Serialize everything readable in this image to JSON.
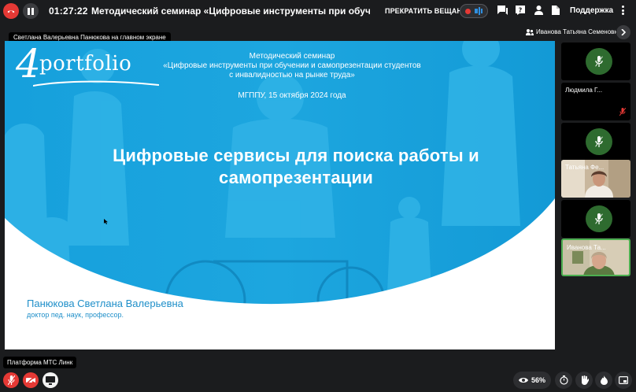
{
  "topbar": {
    "timer": "01:27:22",
    "meeting_title": "Методический семинар «Цифровые инструменты при обучении и самопрезентации студентов с инвалидностью на рынке труда»",
    "stop_stream_label": "ПРЕКРАТИТЬ ВЕЩАНИЕ",
    "support_label": "Поддержка",
    "icons": [
      "hang-up-icon",
      "pause-icon",
      "record-dot-icon",
      "stream-icon",
      "chat-icon",
      "question-icon",
      "user-icon",
      "document-icon",
      "more-icon"
    ]
  },
  "main_screen_label": "Светлана Валерьевна Панюкова на главном экране",
  "active_speaker": "Иванова Татьяна Семеновна",
  "slide": {
    "logo_number": "4",
    "logo_word": "portfolio",
    "header_line1": "Методический семинар",
    "header_line2": "«Цифровые инструменты при обучении и самопрезентации студентов",
    "header_line3": "с инвалидностью на рынке труда»",
    "date": "МГППУ, 15 октября 2024 года",
    "title_line1": "Цифровые сервисы для поиска работы и",
    "title_line2": "самопрезентации",
    "author_name": "Панюкова Светлана Валерьевна",
    "author_title": "доктор пед. наук, профессор."
  },
  "participants": [
    {
      "name": "",
      "kind": "mic"
    },
    {
      "name": "Людмила Г...",
      "kind": "name-muted"
    },
    {
      "name": "",
      "kind": "mic"
    },
    {
      "name": "Татьяна Фе...",
      "kind": "video"
    },
    {
      "name": "",
      "kind": "mic"
    },
    {
      "name": "Иванова Та...",
      "kind": "video-active"
    }
  ],
  "bottombar": {
    "platform_label": "Платформа МТС Линк",
    "viewers_percent": "56%"
  },
  "colors": {
    "accent_red": "#e53935",
    "slide_blue": "#1aa3de",
    "mic_green": "#2e6b2f",
    "active_border": "#4caf50"
  }
}
